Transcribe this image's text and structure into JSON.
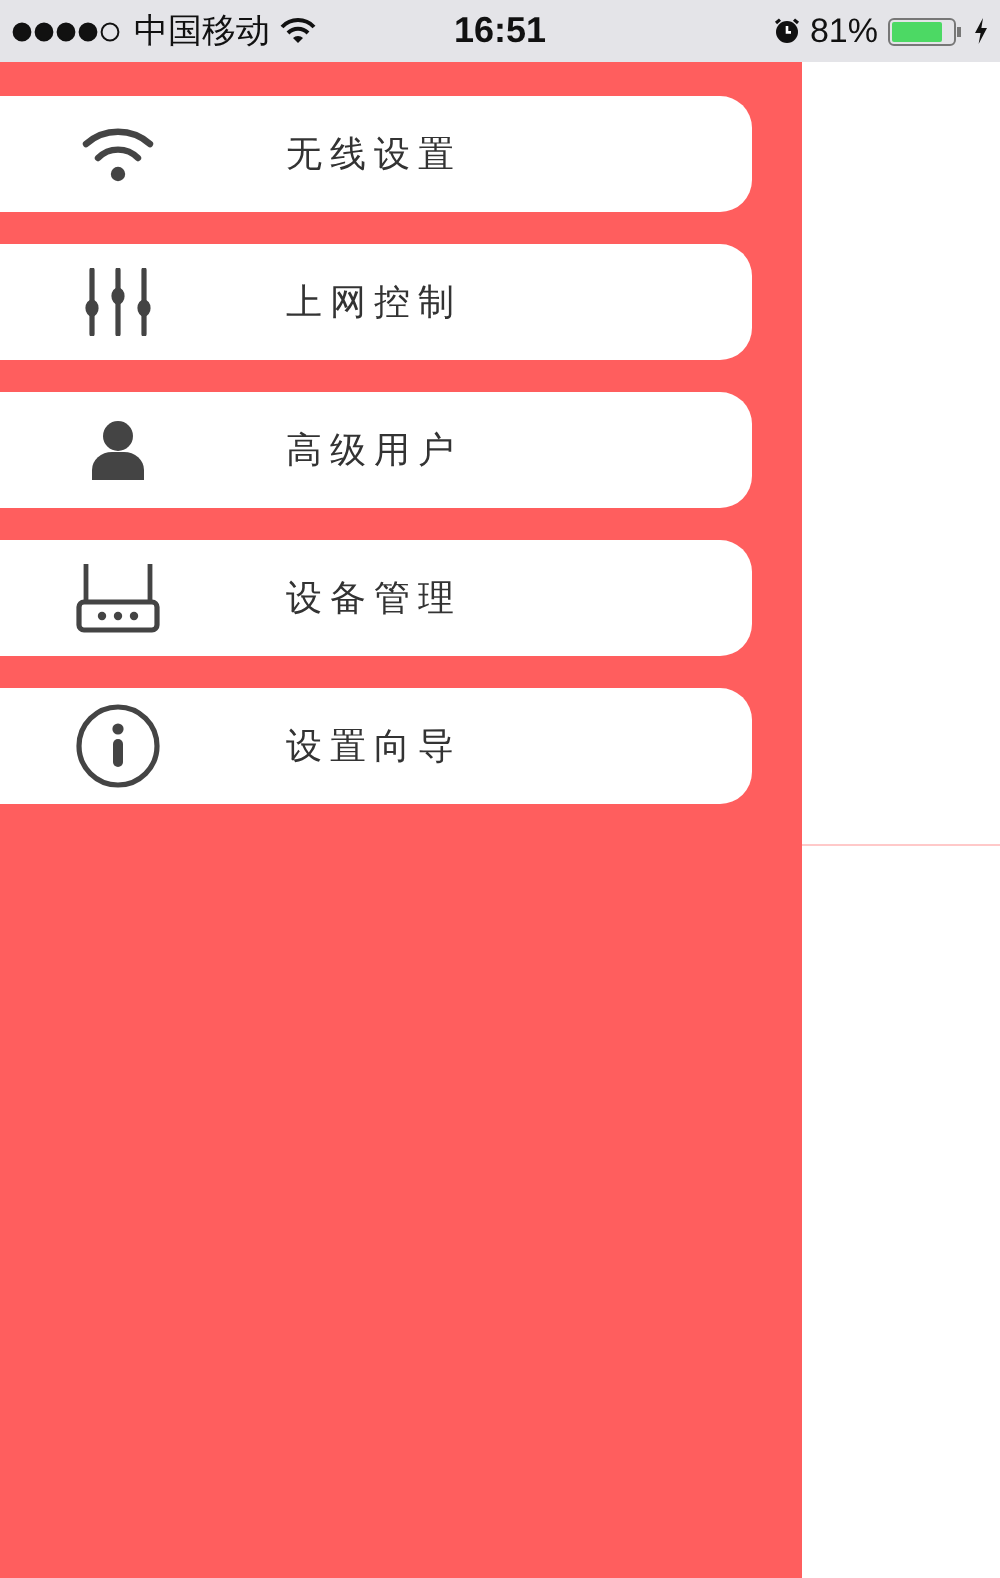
{
  "status_bar": {
    "carrier": "中国移动",
    "time": "16:51",
    "battery_percent": "81%"
  },
  "menu": [
    {
      "kind": "wifi",
      "label": "无线设置"
    },
    {
      "kind": "sliders",
      "label": "上网控制"
    },
    {
      "kind": "user",
      "label": "高级用户"
    },
    {
      "kind": "router",
      "label": "设备管理"
    },
    {
      "kind": "info",
      "label": "设置向导"
    }
  ]
}
